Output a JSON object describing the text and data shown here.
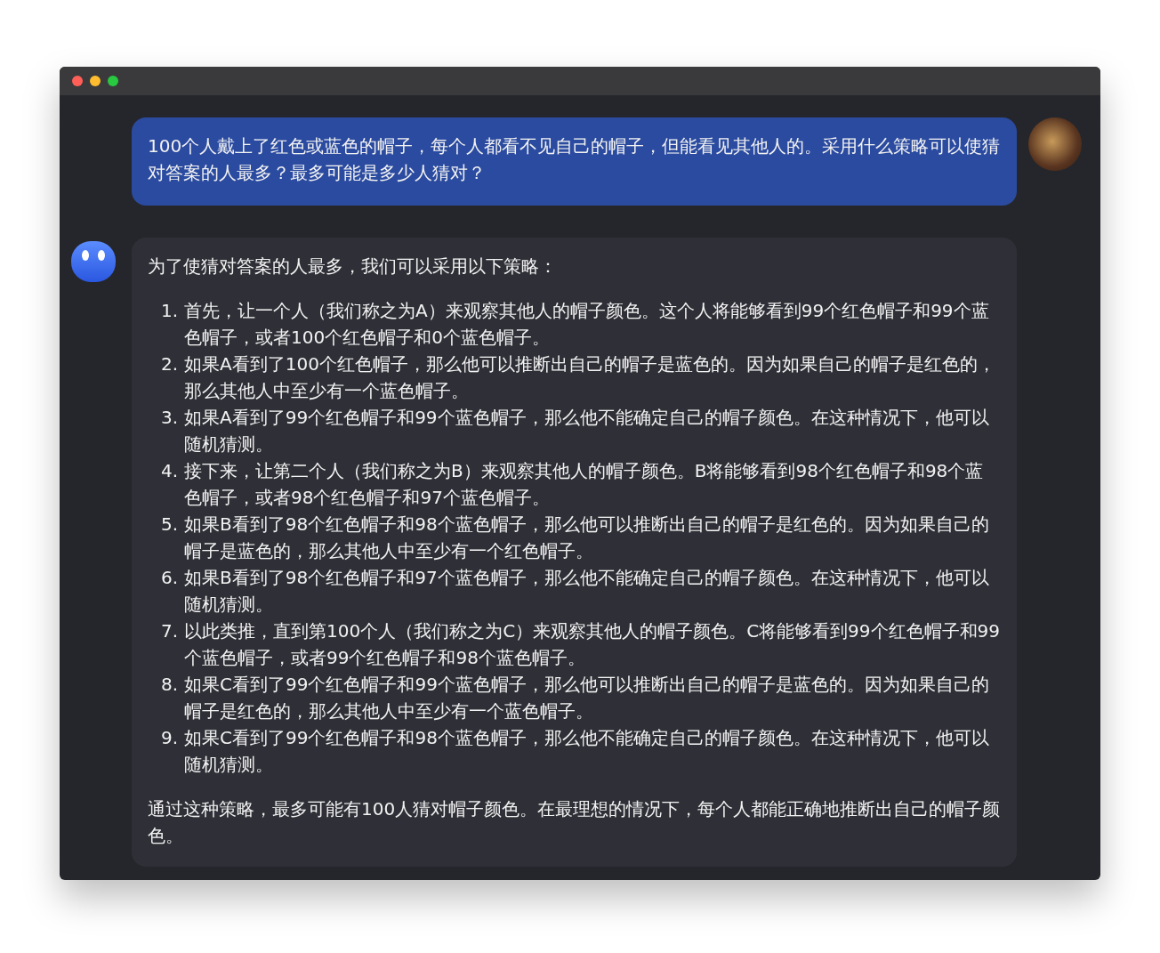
{
  "messages": [
    {
      "kind": "user",
      "text": "100个人戴上了红色或蓝色的帽子，每个人都看不见自己的帽子，但能看见其他人的。采用什么策略可以使猜对答案的人最多？最多可能是多少人猜对？"
    },
    {
      "kind": "assistant",
      "intro": "为了使猜对答案的人最多，我们可以采用以下策略：",
      "steps": [
        {
          "number": "1.",
          "text": "首先，让一个人（我们称之为A）来观察其他人的帽子颜色。这个人将能够看到99个红色帽子和99个蓝色帽子，或者100个红色帽子和0个蓝色帽子。"
        },
        {
          "number": "2.",
          "text": "如果A看到了100个红色帽子，那么他可以推断出自己的帽子是蓝色的。因为如果自己的帽子是红色的，那么其他人中至少有一个蓝色帽子。"
        },
        {
          "number": "3.",
          "text": "如果A看到了99个红色帽子和99个蓝色帽子，那么他不能确定自己的帽子颜色。在这种情况下，他可以随机猜测。"
        },
        {
          "number": "4.",
          "text": "接下来，让第二个人（我们称之为B）来观察其他人的帽子颜色。B将能够看到98个红色帽子和98个蓝色帽子，或者98个红色帽子和97个蓝色帽子。"
        },
        {
          "number": "5.",
          "text": "如果B看到了98个红色帽子和98个蓝色帽子，那么他可以推断出自己的帽子是红色的。因为如果自己的帽子是蓝色的，那么其他人中至少有一个红色帽子。"
        },
        {
          "number": "6.",
          "text": "如果B看到了98个红色帽子和97个蓝色帽子，那么他不能确定自己的帽子颜色。在这种情况下，他可以随机猜测。"
        },
        {
          "number": "7.",
          "text": "以此类推，直到第100个人（我们称之为C）来观察其他人的帽子颜色。C将能够看到99个红色帽子和99个蓝色帽子，或者99个红色帽子和98个蓝色帽子。"
        },
        {
          "number": "8.",
          "text": "如果C看到了99个红色帽子和99个蓝色帽子，那么他可以推断出自己的帽子是蓝色的。因为如果自己的帽子是红色的，那么其他人中至少有一个蓝色帽子。"
        },
        {
          "number": "9.",
          "text": "如果C看到了99个红色帽子和98个蓝色帽子，那么他不能确定自己的帽子颜色。在这种情况下，他可以随机猜测。"
        }
      ],
      "conclusion": "通过这种策略，最多可能有100人猜对帽子颜色。在最理想的情况下，每个人都能正确地推断出自己的帽子颜色。"
    }
  ]
}
